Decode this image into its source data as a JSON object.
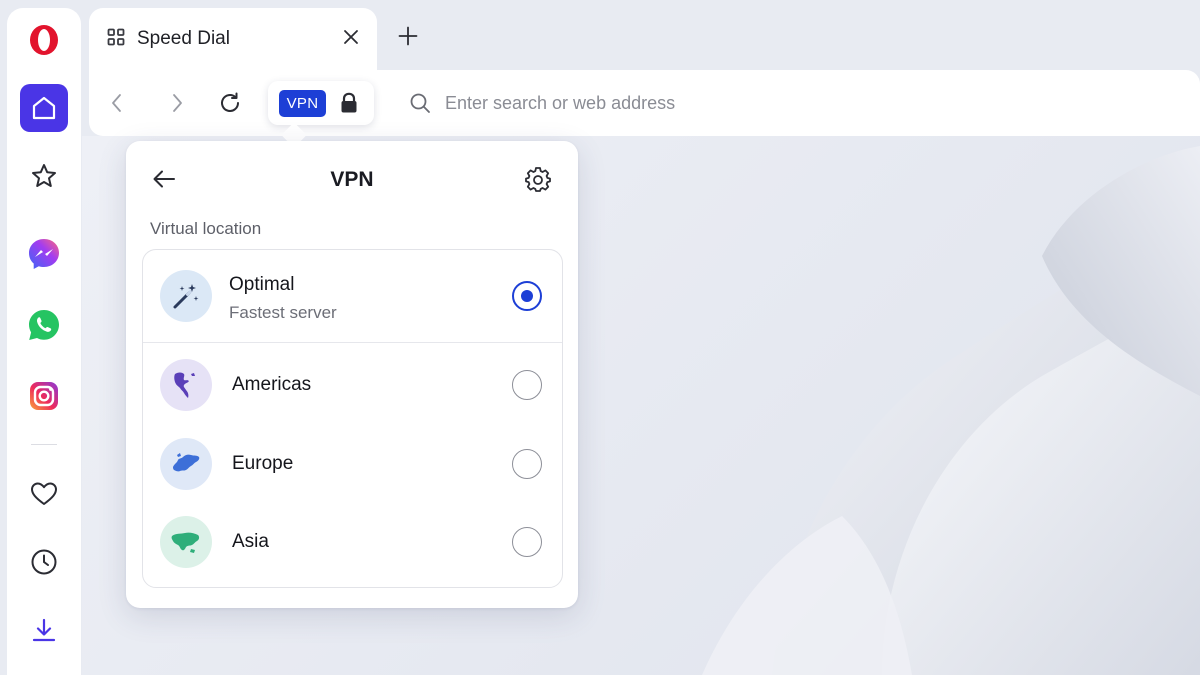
{
  "tab": {
    "title": "Speed Dial"
  },
  "address": {
    "placeholder": "Enter search or web address"
  },
  "vpn_badge": "VPN",
  "popup": {
    "title": "VPN",
    "section_label": "Virtual location",
    "locations": [
      {
        "name": "Optimal",
        "subtitle": "Fastest server",
        "selected": true,
        "icon": "magic-wand-icon",
        "icon_bg": "#dbe8f6"
      },
      {
        "name": "Americas",
        "selected": false,
        "icon": "globe-americas-icon",
        "icon_bg": "#e6e2f6"
      },
      {
        "name": "Europe",
        "selected": false,
        "icon": "globe-europe-icon",
        "icon_bg": "#dfe8f7"
      },
      {
        "name": "Asia",
        "selected": false,
        "icon": "globe-asia-icon",
        "icon_bg": "#dcf1e8"
      }
    ]
  },
  "colors": {
    "accent": "#1d3fd6",
    "sidebar_active": "#4a35e6",
    "opera_red": "#e2142d"
  },
  "sidebar": {
    "items": [
      "opera-logo",
      "home-icon",
      "star-icon",
      "messenger-icon",
      "whatsapp-icon",
      "instagram-icon",
      "heart-icon",
      "clock-icon",
      "download-icon"
    ]
  }
}
